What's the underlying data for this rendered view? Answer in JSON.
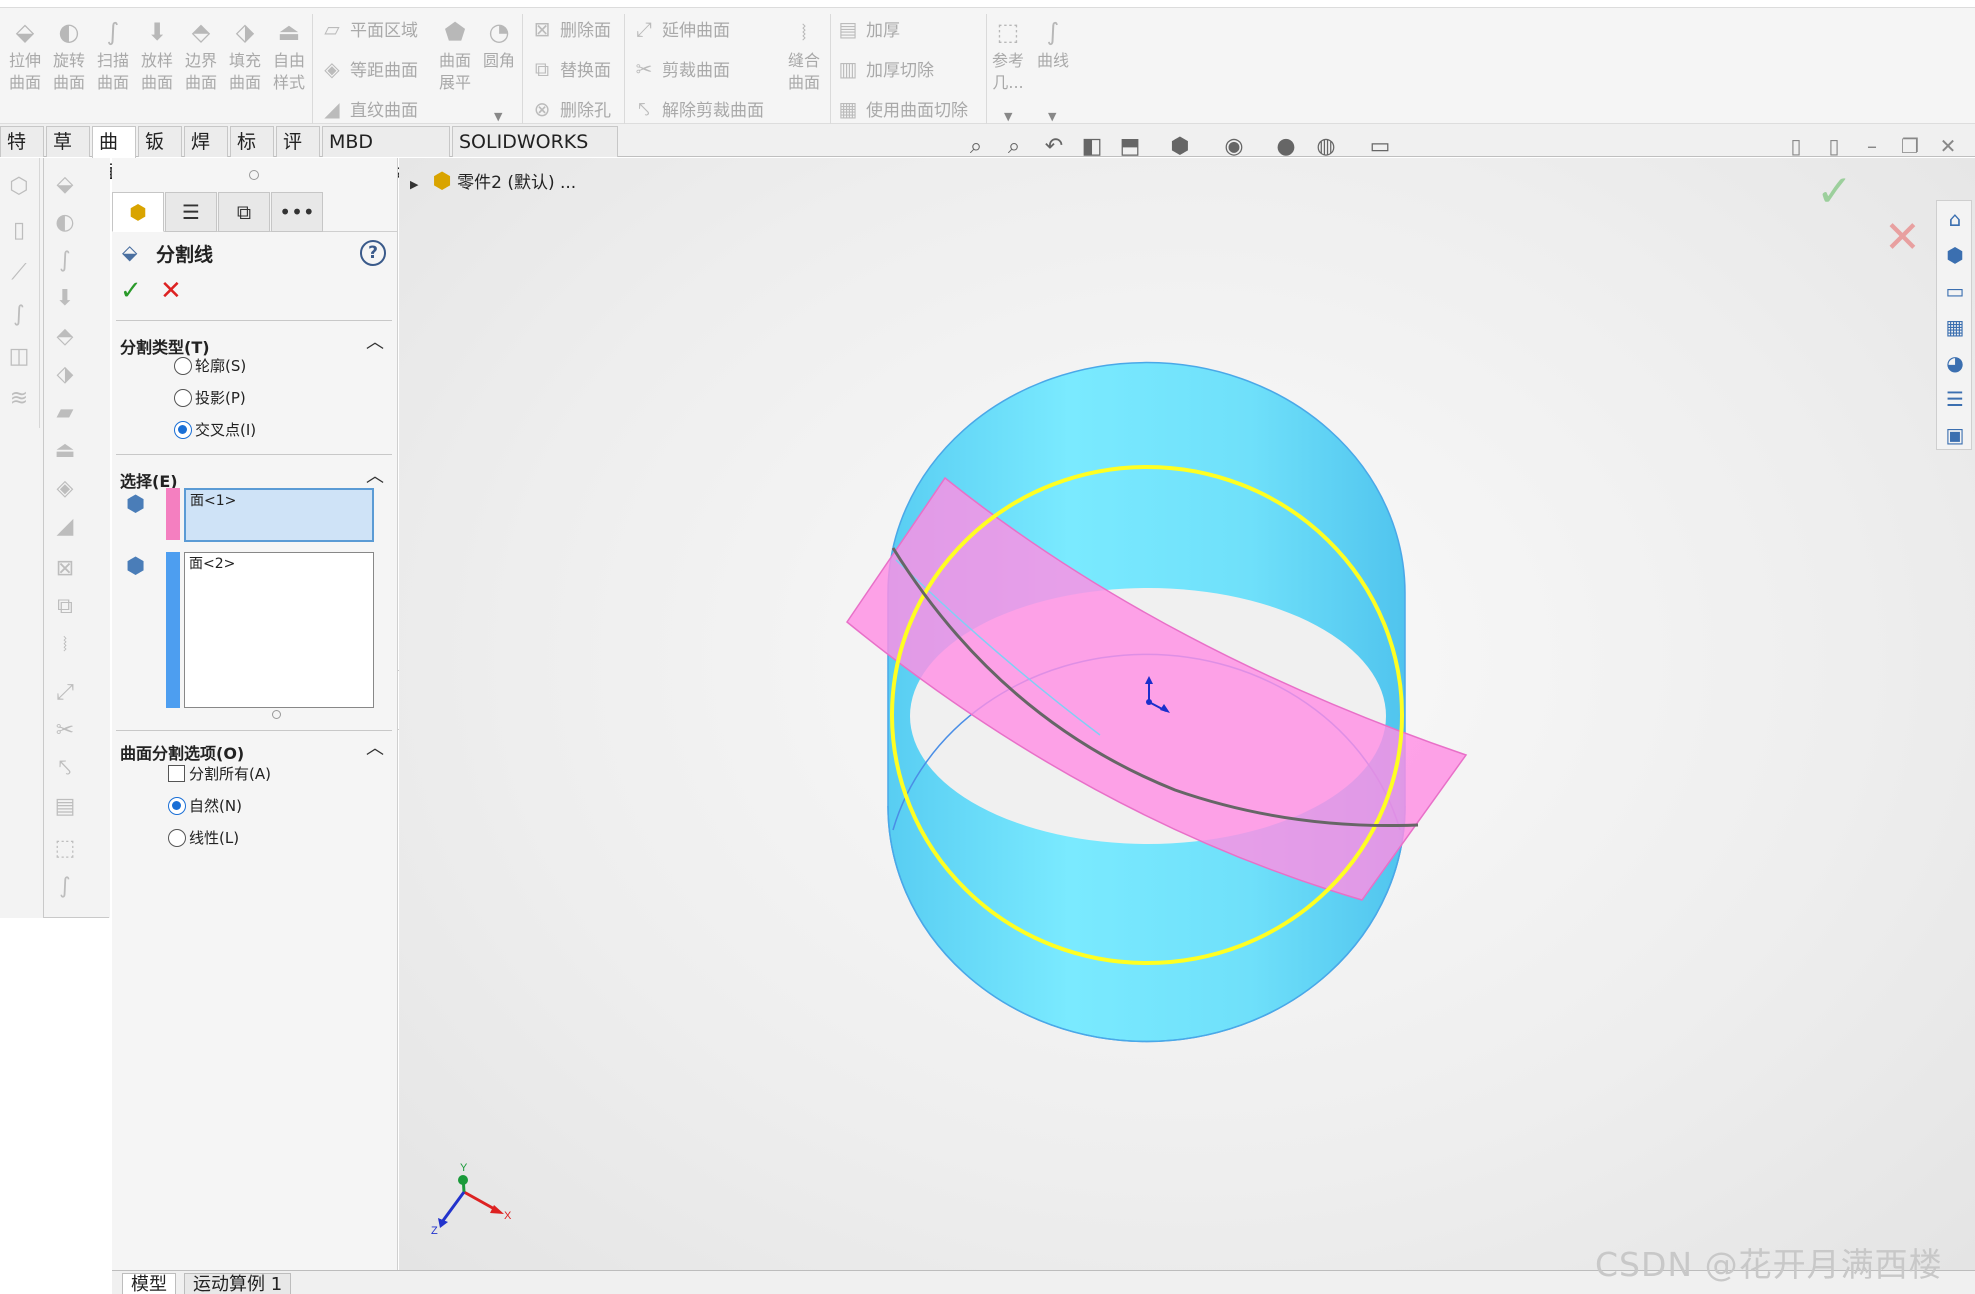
{
  "ribbon": {
    "big_buttons": [
      {
        "label": "拉伸\n曲面",
        "icon": "extrude-surface-icon"
      },
      {
        "label": "旋转\n曲面",
        "icon": "revolve-surface-icon"
      },
      {
        "label": "扫描\n曲面",
        "icon": "sweep-surface-icon"
      },
      {
        "label": "放样\n曲面",
        "icon": "loft-surface-icon"
      },
      {
        "label": "边界\n曲面",
        "icon": "boundary-surface-icon"
      },
      {
        "label": "填充\n曲面",
        "icon": "fill-surface-icon"
      },
      {
        "label": "自由\n样式",
        "icon": "freeform-icon"
      }
    ],
    "planar": "平面区域",
    "offset": "等距曲面",
    "ruled": "直纹曲面",
    "flatten": "曲面\n展平",
    "fillet": "圆角",
    "delete_face": "删除面",
    "replace_face": "替换面",
    "delete_hole": "删除孔",
    "extend": "延伸曲面",
    "trim": "剪裁曲面",
    "untrim": "解除剪裁曲面",
    "knit": "缝合\n曲面",
    "thicken": "加厚",
    "thicken_cut": "加厚切除",
    "surface_cut": "使用曲面切除",
    "ref_geom": "参考\n几...",
    "curves": "曲线"
  },
  "tabs": [
    "特征",
    "草图",
    "曲面",
    "钣金",
    "焊件",
    "标注",
    "评估",
    "MBD Dimensions",
    "SOLIDWORKS 插件"
  ],
  "active_tab": "曲面",
  "tree": {
    "part": "零件2 (默认) ..."
  },
  "pm": {
    "title": "分割线",
    "section_type": {
      "title": "分割类型(T)",
      "options": [
        "轮廓(S)",
        "投影(P)",
        "交叉点(I)"
      ],
      "selected": "交叉点(I)"
    },
    "section_select": {
      "title": "选择(E)",
      "box1": "面<1>",
      "box2": "面<2>",
      "color1": "#f47fc0",
      "color2": "#4d9ef0"
    },
    "section_options": {
      "title": "曲面分割选项(O)",
      "checkbox": "分割所有(A)",
      "options": [
        "自然(N)",
        "线性(L)"
      ],
      "selected": "自然(N)"
    }
  },
  "triad": {
    "x": "X",
    "y": "Y",
    "z": "Z"
  },
  "bottom_tabs": [
    "模型",
    "运动算例 1"
  ],
  "watermark": "CSDN @花开月满西楼",
  "colors": {
    "cylinder": "#7ee8ff",
    "sheet": "#ff8fe4",
    "intersection_circle": "#ffff00",
    "split_curve": "#666666"
  }
}
